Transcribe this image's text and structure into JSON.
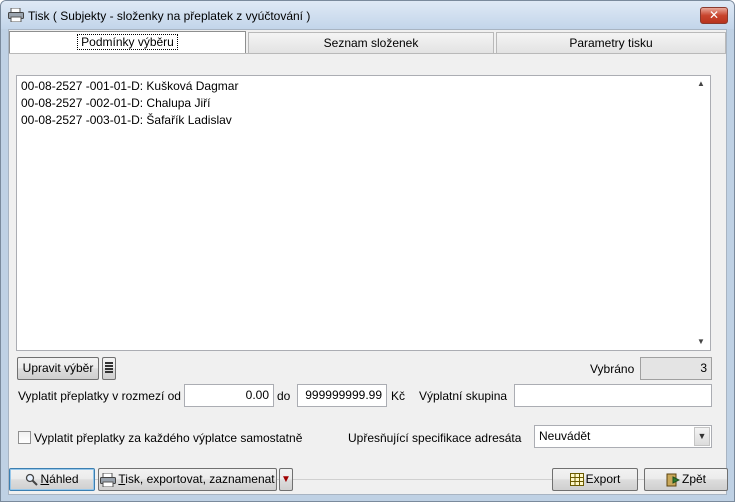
{
  "window": {
    "title": "Tisk ( Subjekty - složenky na přeplatek z vyúčtování )",
    "close_label": "✕"
  },
  "tabs": [
    {
      "label": "Podmínky výběru",
      "active": true
    },
    {
      "label": "Seznam složenek",
      "active": false
    },
    {
      "label": "Parametry tisku",
      "active": false
    }
  ],
  "selection_list": {
    "items": [
      "00-08-2527 -001-01-D: Kušková Dagmar",
      "00-08-2527 -002-01-D: Chalupa Jiří",
      "00-08-2527 -003-01-D: Šafařík Ladislav"
    ]
  },
  "edit_selection": {
    "button_label": "Upravit výběr",
    "selected_label": "Vybráno",
    "selected_count": "3"
  },
  "overpayment_range": {
    "label": "Vyplatit přeplatky v rozmezí od",
    "from_value": "0.00",
    "to_label": "do",
    "to_value": "999999999.99",
    "currency": "Kč",
    "group_label": "Výplatní skupina",
    "group_value": ""
  },
  "per_payer": {
    "checkbox_label": "Vyplatit přeplatky za každého výplatce samostatně",
    "checked": false
  },
  "address_spec": {
    "label": "Upřesňující specifikace adresáta",
    "value": "Neuvádět"
  },
  "footer": {
    "preview_prefix": "N",
    "preview_rest": "áhled",
    "print_prefix": "T",
    "print_rest": "isk, exportovat, zaznamenat",
    "export_label": "Export",
    "back_label": "Zpět"
  },
  "colors": {
    "accent": "#3c7fb1",
    "close_red": "#c8442d",
    "dropdown_arrow": "#a00000"
  }
}
